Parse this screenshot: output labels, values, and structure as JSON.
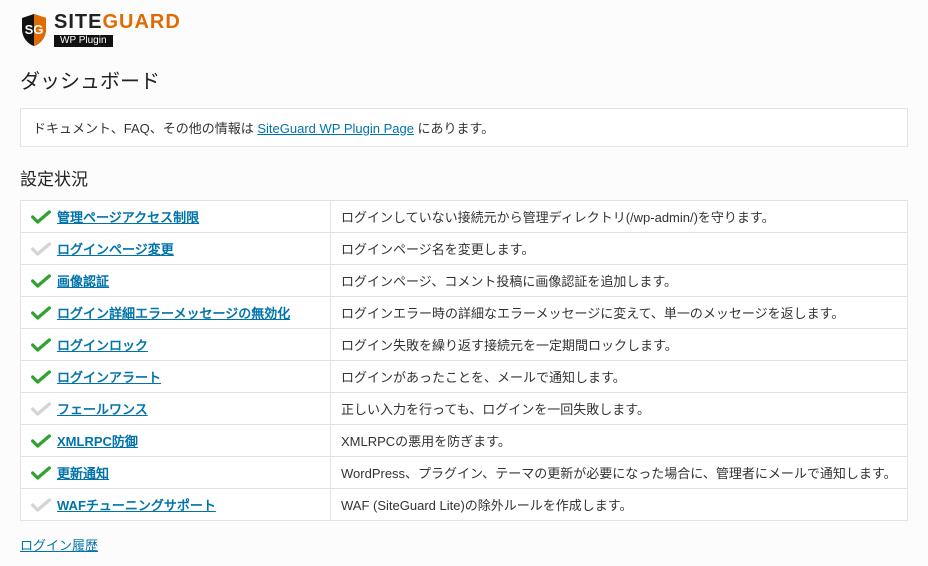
{
  "brand": {
    "name_main": "SITE",
    "name_accent": "GUARD",
    "badge": "WP Plugin"
  },
  "page_title": "ダッシュボード",
  "info": {
    "prefix": "ドキュメント、FAQ、その他の情報は ",
    "link_text": "SiteGuard WP Plugin Page",
    "suffix": " にあります。"
  },
  "section_title": "設定状況",
  "rows": [
    {
      "enabled": true,
      "label": "管理ページアクセス制限",
      "desc": "ログインしていない接続元から管理ディレクトリ(/wp-admin/)を守ります。"
    },
    {
      "enabled": false,
      "label": "ログインページ変更",
      "desc": "ログインページ名を変更します。"
    },
    {
      "enabled": true,
      "label": "画像認証",
      "desc": "ログインページ、コメント投稿に画像認証を追加します。"
    },
    {
      "enabled": true,
      "label": "ログイン詳細エラーメッセージの無効化",
      "desc": "ログインエラー時の詳細なエラーメッセージに変えて、単一のメッセージを返します。"
    },
    {
      "enabled": true,
      "label": "ログインロック",
      "desc": "ログイン失敗を繰り返す接続元を一定期間ロックします。"
    },
    {
      "enabled": true,
      "label": "ログインアラート",
      "desc": "ログインがあったことを、メールで通知します。"
    },
    {
      "enabled": false,
      "label": "フェールワンス",
      "desc": "正しい入力を行っても、ログインを一回失敗します。"
    },
    {
      "enabled": true,
      "label": "XMLRPC防御",
      "desc": "XMLRPCの悪用を防ぎます。"
    },
    {
      "enabled": true,
      "label": "更新通知",
      "desc": "WordPress、プラグイン、テーマの更新が必要になった場合に、管理者にメールで通知します。"
    },
    {
      "enabled": false,
      "label": "WAFチューニングサポート",
      "desc": "WAF (SiteGuard Lite)の除外ルールを作成します。"
    }
  ],
  "login_history_link": "ログイン履歴"
}
